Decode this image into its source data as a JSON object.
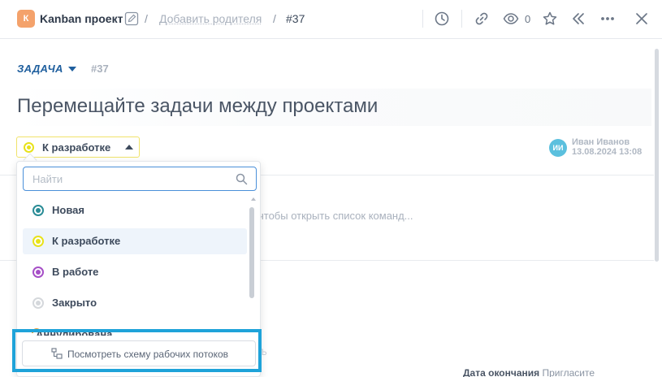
{
  "header": {
    "project_badge": "К",
    "project_name": "Kanban проект",
    "slash": "/",
    "add_parent": "Добавить родителя",
    "task_id": "#37",
    "watch_count": "0"
  },
  "task": {
    "type_label": "ЗАДАЧА",
    "number": "#37",
    "title": "Перемещайте задачи между проектами",
    "status": "К разработке",
    "author_initials": "ИИ",
    "author_name": "Иван Иванов",
    "author_date": "13.08.2024 13:08",
    "editor_hint": "чтобы открыть список команд...",
    "bottom_right_label": "Дата окончания",
    "bottom_right_value": "Пригласите"
  },
  "status_dropdown": {
    "search_placeholder": "Найти",
    "options": [
      {
        "label": "Новая",
        "color": "#2a8c96"
      },
      {
        "label": "К разработке",
        "color": "#e8e21a",
        "selected": true
      },
      {
        "label": "В работе",
        "color": "#a64fc7"
      },
      {
        "label": "Закрыто",
        "color": "#d5d8dc"
      }
    ],
    "partial_option": "Аннулирована",
    "workflow_button": "Посмотреть схему рабочих потоков"
  },
  "colors": {
    "accent": "#1f5f9e",
    "highlight": "#1fa3d9",
    "project_badge": "#f4a26b",
    "avatar": "#5bc0de"
  }
}
